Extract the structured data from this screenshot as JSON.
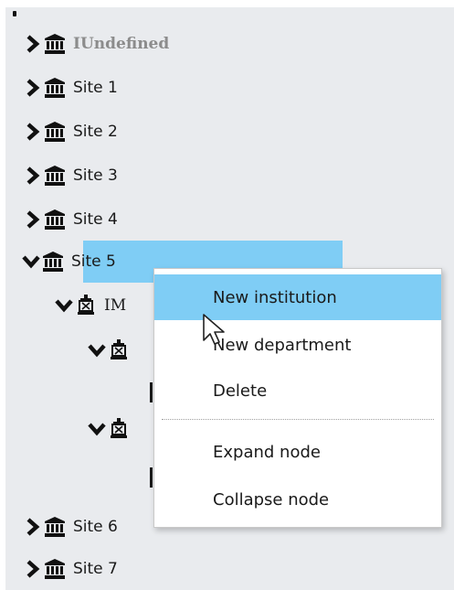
{
  "tree": {
    "items": [
      {
        "label": "IUndefined",
        "icon": "institution-icon",
        "state": "collapsed"
      },
      {
        "label": "Site 1",
        "icon": "institution-icon",
        "state": "collapsed"
      },
      {
        "label": "Site 2",
        "icon": "institution-icon",
        "state": "collapsed"
      },
      {
        "label": "Site 3",
        "icon": "institution-icon",
        "state": "collapsed"
      },
      {
        "label": "Site 4",
        "icon": "institution-icon",
        "state": "collapsed"
      },
      {
        "label": "Site 5",
        "icon": "institution-icon",
        "state": "expanded",
        "selected": true
      },
      {
        "label": "IM",
        "icon": "department-icon",
        "state": "expanded"
      },
      {
        "label": "",
        "icon": "department-icon",
        "state": "expanded"
      },
      {
        "label": "",
        "icon": "department-icon",
        "state": "expanded"
      },
      {
        "label": "Site 6",
        "icon": "institution-icon",
        "state": "collapsed"
      },
      {
        "label": "Site 7",
        "icon": "institution-icon",
        "state": "collapsed"
      }
    ]
  },
  "context_menu": {
    "items": [
      {
        "label": "New institution",
        "highlighted": true
      },
      {
        "label": "New department"
      },
      {
        "label": "Delete"
      },
      {
        "label": "Expand node"
      },
      {
        "label": "Collapse node"
      }
    ]
  },
  "colors": {
    "panel_bg": "#e9ebee",
    "selection": "#7fcdf5",
    "menu_bg": "#ffffff"
  }
}
